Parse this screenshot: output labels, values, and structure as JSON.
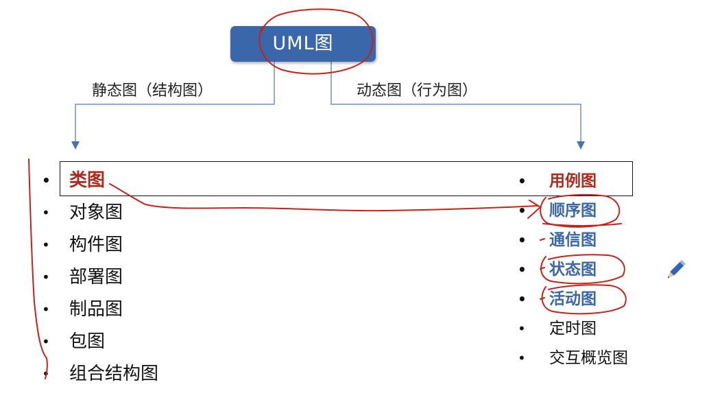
{
  "diagram": {
    "root": "UML图",
    "branches": {
      "static": {
        "label": "静态图（结构图）",
        "items": [
          "类图",
          "对象图",
          "构件图",
          "部署图",
          "制品图",
          "包图",
          "组合结构图"
        ]
      },
      "dynamic": {
        "label": "动态图（行为图）",
        "items": [
          "用例图",
          "顺序图",
          "通信图",
          "状态图",
          "活动图",
          "定时图",
          "交互概览图"
        ]
      }
    },
    "bullet": "•",
    "colors": {
      "root_fill": "#3a67a9",
      "emphasis_red": "#b0281b",
      "emphasis_blue": "#3a67a9",
      "annotation_red": "#c8201a",
      "connector": "#4a72b0"
    }
  }
}
